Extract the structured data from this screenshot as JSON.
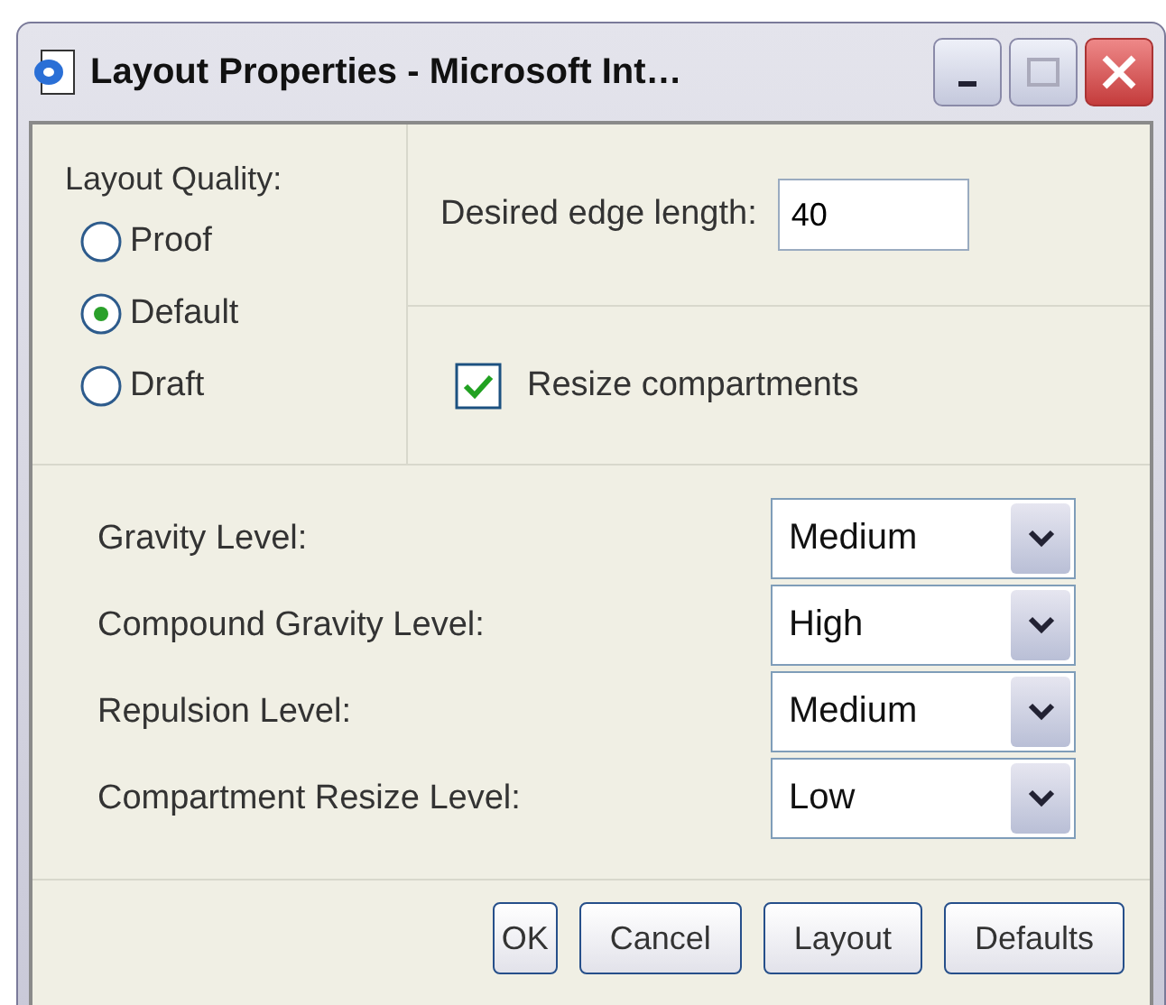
{
  "window": {
    "title": "Layout Properties - Microsoft Int…"
  },
  "quality": {
    "label": "Layout Quality:",
    "options": [
      {
        "label": "Proof",
        "selected": false
      },
      {
        "label": "Default",
        "selected": true
      },
      {
        "label": "Draft",
        "selected": false
      }
    ]
  },
  "edge_length": {
    "label": "Desired edge length:",
    "value": "40"
  },
  "resize_compartments": {
    "label": "Resize compartments",
    "checked": true
  },
  "levels": [
    {
      "label": "Gravity Level:",
      "value": "Medium"
    },
    {
      "label": "Compound Gravity Level:",
      "value": "High"
    },
    {
      "label": "Repulsion Level:",
      "value": "Medium"
    },
    {
      "label": "Compartment Resize Level:",
      "value": "Low"
    }
  ],
  "buttons": [
    "OK",
    "Cancel",
    "Layout",
    "Defaults"
  ]
}
